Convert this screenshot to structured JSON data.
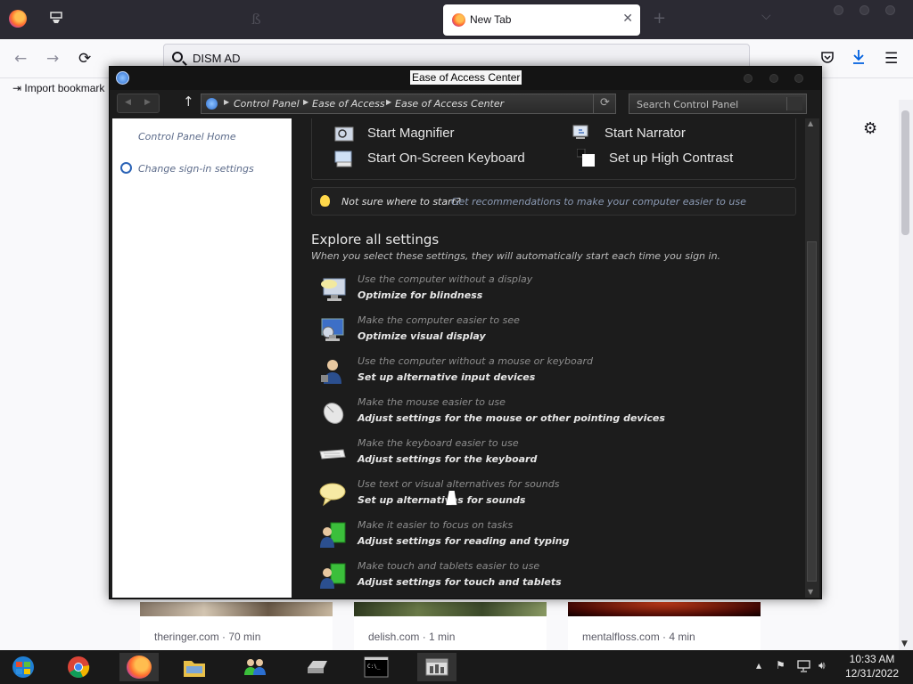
{
  "browser": {
    "tab_title": "New Tab",
    "tab_close": "✕",
    "new_tab": "+",
    "list_all_tabs": "⌵",
    "url_text": "DISM AD",
    "back": "←",
    "forward": "→",
    "reload": "⟳",
    "menu": "☰",
    "bookmark_label": "Import bookmark",
    "settings_glyph": "⚙",
    "tiles": [
      {
        "label": "theringer.com · 70 min"
      },
      {
        "label": "delish.com · 1 min"
      },
      {
        "label": "mentalfloss.com · 4 min"
      }
    ]
  },
  "window": {
    "title": "Ease of Access Center",
    "breadcrumb": [
      "Control Panel",
      "Ease of Access",
      "Ease of Access Center"
    ],
    "search_placeholder": "Search Control Panel",
    "up_arrow": "↑",
    "refresh": "⟳"
  },
  "left_pane": {
    "links": [
      "Control Panel Home",
      "Change sign-in settings"
    ]
  },
  "quick_access": {
    "items": [
      {
        "label": "Start Magnifier",
        "icon": "magnifier-icon"
      },
      {
        "label": "Start Narrator",
        "icon": "narrator-icon"
      },
      {
        "label": "Start On-Screen Keyboard",
        "icon": "keyboard-icon"
      },
      {
        "label": "Set up High Contrast",
        "icon": "high-contrast-icon"
      }
    ]
  },
  "hint": {
    "question": "Not sure where to start?",
    "link": "Get recommendations to make your computer easier to use"
  },
  "explore": {
    "heading": "Explore all settings",
    "subtitle": "When you select these settings, they will automatically start each time you sign in.",
    "rows": [
      {
        "desc": "Use the computer without a display",
        "action": "Optimize for blindness",
        "icon": "display-icon"
      },
      {
        "desc": "Make the computer easier to see",
        "action": "Optimize visual display",
        "icon": "monitor-icon"
      },
      {
        "desc": "Use the computer without a mouse or keyboard",
        "action": "Set up alternative input devices",
        "icon": "person-icon"
      },
      {
        "desc": "Make the mouse easier to use",
        "action": "Adjust settings for the mouse or other pointing devices",
        "icon": "mouse-icon"
      },
      {
        "desc": "Make the keyboard easier to use",
        "action": "Adjust settings for the keyboard",
        "icon": "keyboard-icon"
      },
      {
        "desc": "Use text or visual alternatives for sounds",
        "action": "Set up alternatives for sounds",
        "icon": "speech-bubble-icon"
      },
      {
        "desc": "Make it easier to focus on tasks",
        "action": "Adjust settings for reading and typing",
        "icon": "focus-icon"
      },
      {
        "desc": "Make touch and tablets easier to use",
        "action": "Adjust settings for touch and tablets",
        "icon": "tablet-icon"
      }
    ]
  },
  "taskbar": {
    "clock_time": "10:33 AM",
    "clock_date": "12/31/2022",
    "tray_chevron": "▴"
  }
}
